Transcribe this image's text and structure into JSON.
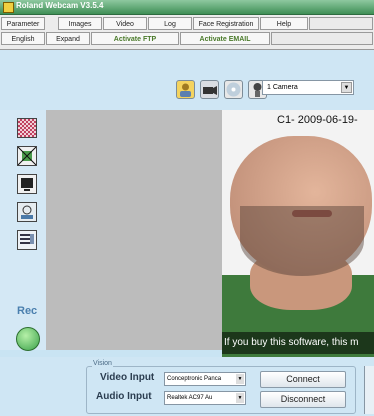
{
  "window": {
    "title": "Roland Webcam V3.5.4"
  },
  "menu_row1": [
    "Parameter",
    "Images",
    "Video",
    "Log",
    "Face Registration",
    "Help"
  ],
  "menu_row2": [
    "English",
    "Expand",
    "Activate FTP",
    "Activate EMAIL"
  ],
  "toolbar": {
    "camera_select": "1 Camera"
  },
  "camera_view": {
    "timestamp": "C1- 2009-06-19-",
    "caption": "If you buy this software, this m"
  },
  "left_panel": {
    "rec_label": "Rec"
  },
  "bottom": {
    "legend": "Vision",
    "video_input_label": "Video Input",
    "video_input_value": "Conceptronic Panca",
    "audio_input_label": "Audio Input",
    "audio_input_value": "Realtek AC97 Au",
    "connect": "Connect",
    "disconnect": "Disconnect"
  },
  "colors": {
    "titlebar": "#3f8f56",
    "rec": "#3aa24a",
    "shirt": "#3e7a3c"
  }
}
